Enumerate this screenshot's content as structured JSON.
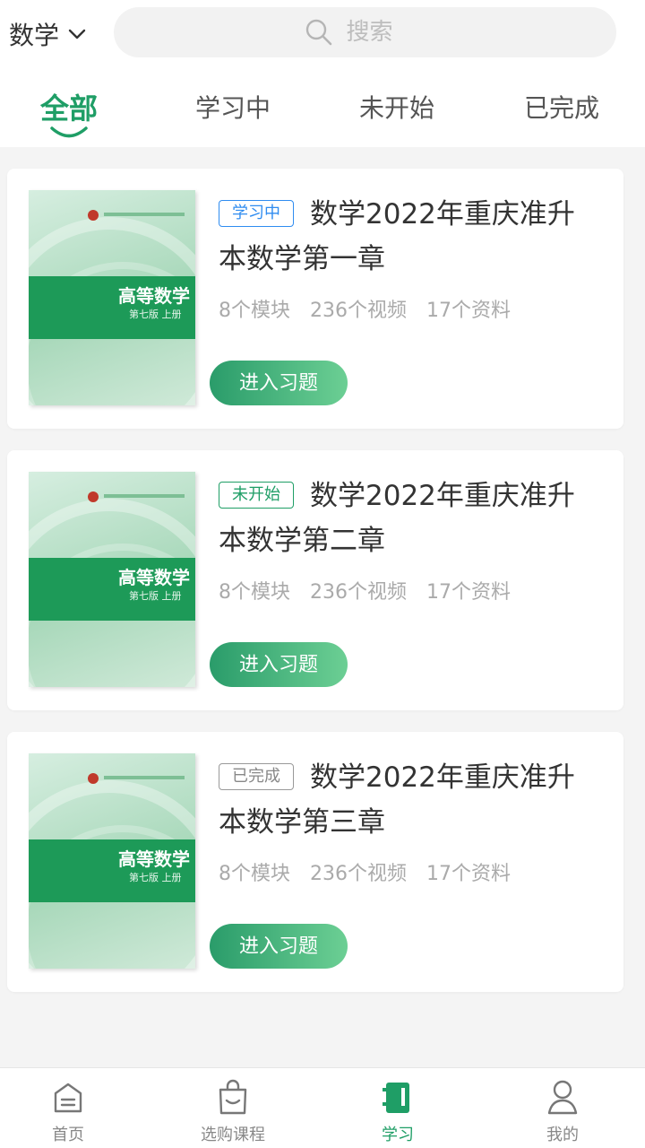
{
  "header": {
    "subject": "数学",
    "subject_icon": "chevron-down-icon",
    "search_placeholder": "搜索",
    "search_icon": "search-icon"
  },
  "tabs": [
    {
      "label": "全部",
      "active": true
    },
    {
      "label": "学习中",
      "active": false
    },
    {
      "label": "未开始",
      "active": false
    },
    {
      "label": "已完成",
      "active": false
    }
  ],
  "courses": [
    {
      "status": "学习中",
      "title": "数学2022年重庆准升本数学第一章",
      "modules": "8个模块",
      "videos": "236个视频",
      "materials": "17个资料",
      "button": "进入习题",
      "cover_title": "高等数学",
      "cover_sub": "第七版 上册"
    },
    {
      "status": "未开始",
      "title": "数学2022年重庆准升本数学第二章",
      "modules": "8个模块",
      "videos": "236个视频",
      "materials": "17个资料",
      "button": "进入习题",
      "cover_title": "高等数学",
      "cover_sub": "第七版 上册"
    },
    {
      "status": "已完成",
      "title": "数学2022年重庆准升本数学第三章",
      "modules": "8个模块",
      "videos": "236个视频",
      "materials": "17个资料",
      "button": "进入习题",
      "cover_title": "高等数学",
      "cover_sub": "第七版 上册"
    }
  ],
  "bottom_nav": [
    {
      "label": "首页",
      "icon": "home-icon",
      "active": false
    },
    {
      "label": "选购课程",
      "icon": "shopping-bag-icon",
      "active": false
    },
    {
      "label": "学习",
      "icon": "notebook-icon",
      "active": true
    },
    {
      "label": "我的",
      "icon": "user-icon",
      "active": false
    }
  ],
  "colors": {
    "accent": "#1f9e66",
    "learning_badge": "#2f8cf0",
    "notstarted_badge": "#1f9e66",
    "done_badge": "#888888"
  }
}
